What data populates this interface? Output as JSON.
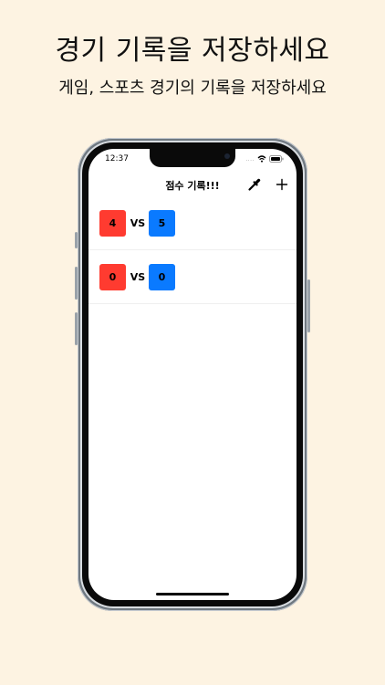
{
  "headline": "경기 기록을 저장하세요",
  "subline": "게임, 스포츠 경기의 기록을 저장하세요",
  "status_bar": {
    "time": "12:37",
    "signal": "...."
  },
  "nav": {
    "title": "점수 기록!!!",
    "left_icon": "eyedropper-icon",
    "right_icon": "plus-icon"
  },
  "records": [
    {
      "home_score": "4",
      "vs": "VS",
      "away_score": "5"
    },
    {
      "home_score": "0",
      "vs": "VS",
      "away_score": "0"
    }
  ],
  "colors": {
    "background": "#FDF3E2",
    "team_red": "#FF3B30",
    "team_blue": "#0A7AFF"
  }
}
